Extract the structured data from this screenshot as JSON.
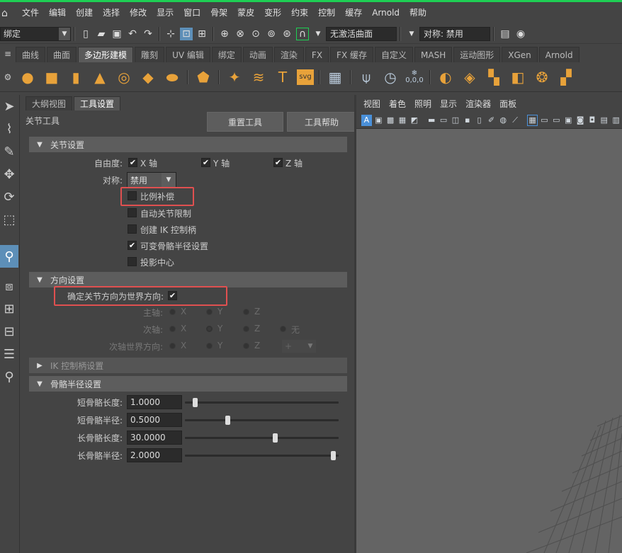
{
  "menubar": {
    "items": [
      "文件",
      "编辑",
      "创建",
      "选择",
      "修改",
      "显示",
      "窗口",
      "骨架",
      "蒙皮",
      "变形",
      "约束",
      "控制",
      "缓存",
      "Arnold",
      "帮助"
    ]
  },
  "statusline": {
    "mode": "绑定",
    "live_surface": "无激活曲面",
    "symmetry": "对称: 禁用"
  },
  "shelf": {
    "tabs": [
      "曲线",
      "曲面",
      "多边形建模",
      "雕刻",
      "UV 编辑",
      "绑定",
      "动画",
      "渲染",
      "FX",
      "FX 缓存",
      "自定义",
      "MASH",
      "运动图形",
      "XGen",
      "Arnold"
    ],
    "active_tab": "多边形建模",
    "icons": [
      "sphere-icon",
      "cube-icon",
      "cylinder-icon",
      "cone-icon",
      "torus-icon",
      "plane-icon",
      "disc-icon",
      "platonic-icon",
      "star-icon",
      "helix-icon",
      "text-icon",
      "svg-icon",
      "grid-icon",
      "pivot-icon",
      "clock-icon",
      "snowflake-icon",
      "combine-icon",
      "separate-icon",
      "boolean-icon",
      "mirror-icon",
      "merge-icon",
      "extract-icon"
    ],
    "svg_label": "svg",
    "text_glyph": "T",
    "snow_label": "0,0,0"
  },
  "toolbox": {
    "icons": [
      "select-arrow-icon",
      "lasso-select-icon",
      "paint-select-icon",
      "move-icon",
      "rotate-icon",
      "scale-icon",
      "joint-tool-icon",
      "layout-icon",
      "four-view-icon",
      "two-view-icon",
      "outliner-icon",
      "zoom-icon"
    ]
  },
  "panel": {
    "tabs": [
      "大纲视图",
      "工具设置"
    ],
    "active_tab": "工具设置",
    "tool_name": "关节工具",
    "reset_button": "重置工具",
    "help_button": "工具帮助",
    "joint_settings": {
      "title": "关节设置",
      "dof_label": "自由度:",
      "x_axis": "X 轴",
      "y_axis": "Y 轴",
      "z_axis": "Z 轴",
      "dof_x": true,
      "dof_y": true,
      "dof_z": true,
      "symmetry_label": "对称:",
      "symmetry_value": "禁用",
      "scale_compensate": "比例补偿",
      "scale_compensate_checked": false,
      "auto_joint_limits": "自动关节限制",
      "auto_joint_limits_checked": false,
      "create_ik_handle": "创建 IK 控制柄",
      "create_ik_handle_checked": false,
      "variable_bone_radius": "可变骨骼半径设置",
      "variable_bone_radius_checked": true,
      "project_centre": "投影中心",
      "project_centre_checked": false
    },
    "orientation_settings": {
      "title": "方向设置",
      "orient_to_world_label": "确定关节方向为世界方向:",
      "orient_to_world_checked": true,
      "primary_axis_label": "主轴:",
      "secondary_axis_label": "次轴:",
      "secondary_world_label": "次轴世界方向:",
      "x": "X",
      "y": "Y",
      "z": "Z",
      "none": "无",
      "plus": "+"
    },
    "ik_settings": {
      "title": "IK 控制柄设置"
    },
    "bone_radius": {
      "title": "骨骼半径设置",
      "rows": [
        {
          "label": "短骨骼长度:",
          "value": "1.0000",
          "slider": 0.05
        },
        {
          "label": "短骨骼半径:",
          "value": "0.5000",
          "slider": 0.27
        },
        {
          "label": "长骨骼长度:",
          "value": "30.0000",
          "slider": 0.59
        },
        {
          "label": "长骨骼半径:",
          "value": "2.0000",
          "slider": 0.98
        }
      ]
    }
  },
  "viewport": {
    "menu": [
      "视图",
      "着色",
      "照明",
      "显示",
      "渲染器",
      "面板"
    ]
  },
  "colors": {
    "accent_green": "#1ecf54",
    "highlight_red": "#e05050",
    "shelf_orange": "#e8a23a",
    "selected_blue": "#5d8fb8"
  }
}
